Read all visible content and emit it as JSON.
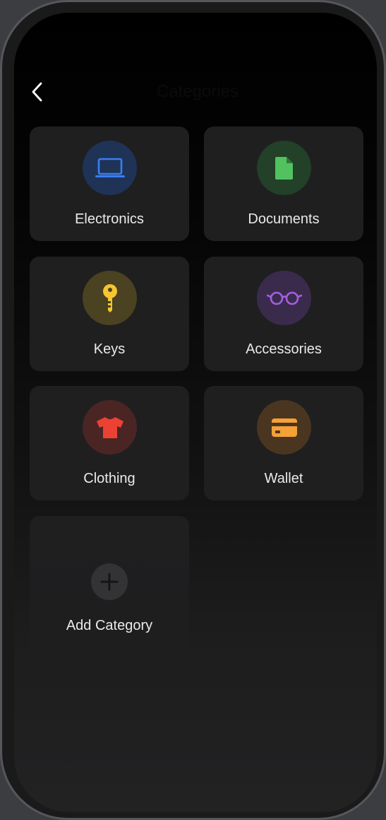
{
  "nav": {
    "title": "Categories"
  },
  "categories": [
    {
      "label": "Electronics",
      "icon": "laptop-icon",
      "color": "#3a7ef6",
      "bg": "#1e3356"
    },
    {
      "label": "Documents",
      "icon": "document-icon",
      "color": "#52c260",
      "bg": "#234028"
    },
    {
      "label": "Keys",
      "icon": "key-icon",
      "color": "#f6c531",
      "bg": "#4a4220"
    },
    {
      "label": "Accessories",
      "icon": "glasses-icon",
      "color": "#a45ee0",
      "bg": "#3a2b4c"
    },
    {
      "label": "Clothing",
      "icon": "tshirt-icon",
      "color": "#ec4233",
      "bg": "#4a2524"
    },
    {
      "label": "Wallet",
      "icon": "credit-card-icon",
      "color": "#f4a138",
      "bg": "#4a3620"
    }
  ],
  "add_category": {
    "label": "Add Category",
    "icon": "plus-icon"
  }
}
